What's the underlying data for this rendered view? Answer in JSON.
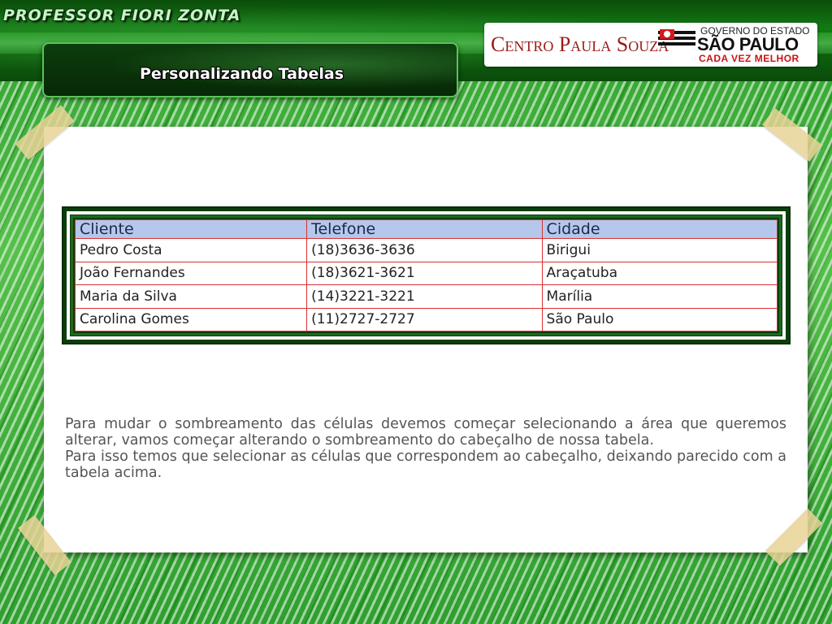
{
  "header": {
    "brand": "PROFESSOR FIORI ZONTA",
    "title": "Personalizando Tabelas",
    "logo_cps": "Centro Paula Souza",
    "logo_gov_line1": "GOVERNO DO ESTADO",
    "logo_gov_line2": "SÃO PAULO",
    "logo_gov_line3": "CADA VEZ MELHOR"
  },
  "table": {
    "headers": [
      "Cliente",
      "Telefone",
      "Cidade"
    ],
    "rows": [
      [
        "Pedro Costa",
        "(18)3636-3636",
        "Birigui"
      ],
      [
        "João Fernandes",
        "(18)3621-3621",
        "Araçatuba"
      ],
      [
        "Maria da Silva",
        "(14)3221-3221",
        "Marília"
      ],
      [
        "Carolina Gomes",
        "(11)2727-2727",
        "São Paulo"
      ]
    ]
  },
  "body": {
    "paragraph1": "Para mudar o sombreamento das células devemos começar selecionando a área que queremos alterar, vamos começar alterando o sombreamento do cabeçalho de nossa tabela.",
    "paragraph2": "Para isso temos que selecionar as células que  correspondem ao cabeçalho, deixando parecido com a tabela acima."
  },
  "colors": {
    "header_fill": "#b5c7eb",
    "grid_lines": "#d83030",
    "frame": "#0c3d0c",
    "cps_red": "#9b1c1c",
    "gov_red": "#cc1111"
  }
}
